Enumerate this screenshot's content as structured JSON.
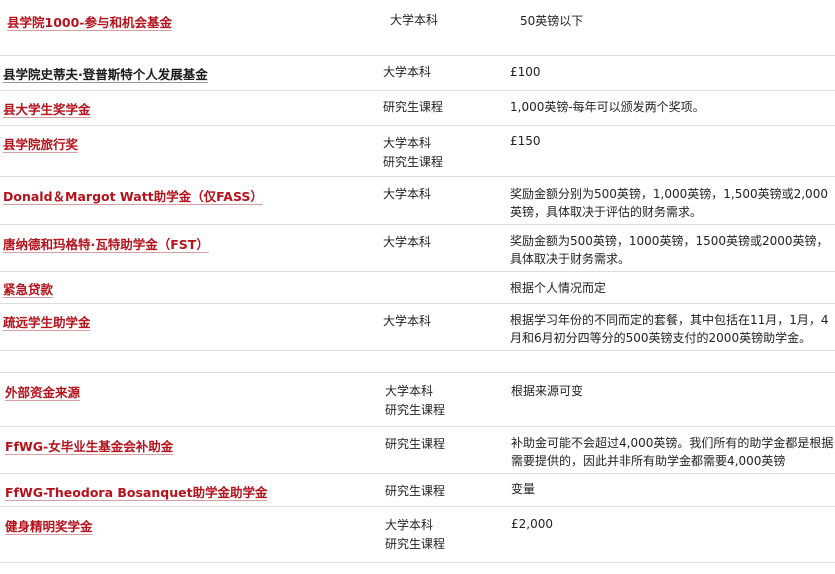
{
  "rows": [
    {
      "name": "县学院1000-参与和机会基金",
      "levels": [
        "大学本科"
      ],
      "amount": "50英镑以下"
    },
    {
      "name": "县学院史蒂夫·登普斯特个人发展基金",
      "levels": [
        "大学本科"
      ],
      "amount": "£100"
    },
    {
      "name": "县大学生奖学金",
      "levels": [
        "研究生课程"
      ],
      "amount": "1,000英镑-每年可以颁发两个奖项。"
    },
    {
      "name": "县学院旅行奖",
      "levels": [
        "大学本科",
        "研究生课程"
      ],
      "amount": "£150"
    },
    {
      "name": "Donald＆Margot Watt助学金（仅FASS）",
      "levels": [
        "大学本科"
      ],
      "amount": "奖励金额分别为500英镑，1,000英镑，1,500英镑或2,000英镑，具体取决于评估的财务需求。"
    },
    {
      "name": "唐纳德和玛格特·瓦特助学金（FST）",
      "levels": [
        "大学本科"
      ],
      "amount": "奖励金额为500英镑，1000英镑，1500英镑或2000英镑，具体取决于财务需求。"
    },
    {
      "name": "紧急贷款",
      "levels": [],
      "amount": "根据个人情况而定"
    },
    {
      "name": "疏远学生助学金",
      "levels": [
        "大学本科"
      ],
      "amount": "根据学习年份的不同而定的套餐，其中包括在11月，1月，4月和6月初分四等分的500英镑支付的2000英镑助学金。"
    },
    {
      "name": "外部资金来源",
      "levels": [
        "大学本科",
        "研究生课程"
      ],
      "amount": "根据来源可变"
    },
    {
      "name": "FfWG-女毕业生基金会补助金",
      "levels": [
        "研究生课程"
      ],
      "amount": "补助金可能不会超过4,000英镑。我们所有的助学金都是根据需要提供的，因此并非所有助学金都需要4,000英镑"
    },
    {
      "name": "FfWG-Theodora Bosanquet助学金助学金",
      "levels": [
        "研究生课程"
      ],
      "amount": "变量"
    },
    {
      "name": "健身精明奖学金",
      "levels": [
        "大学本科",
        "研究生课程"
      ],
      "amount": "£2,000"
    }
  ]
}
